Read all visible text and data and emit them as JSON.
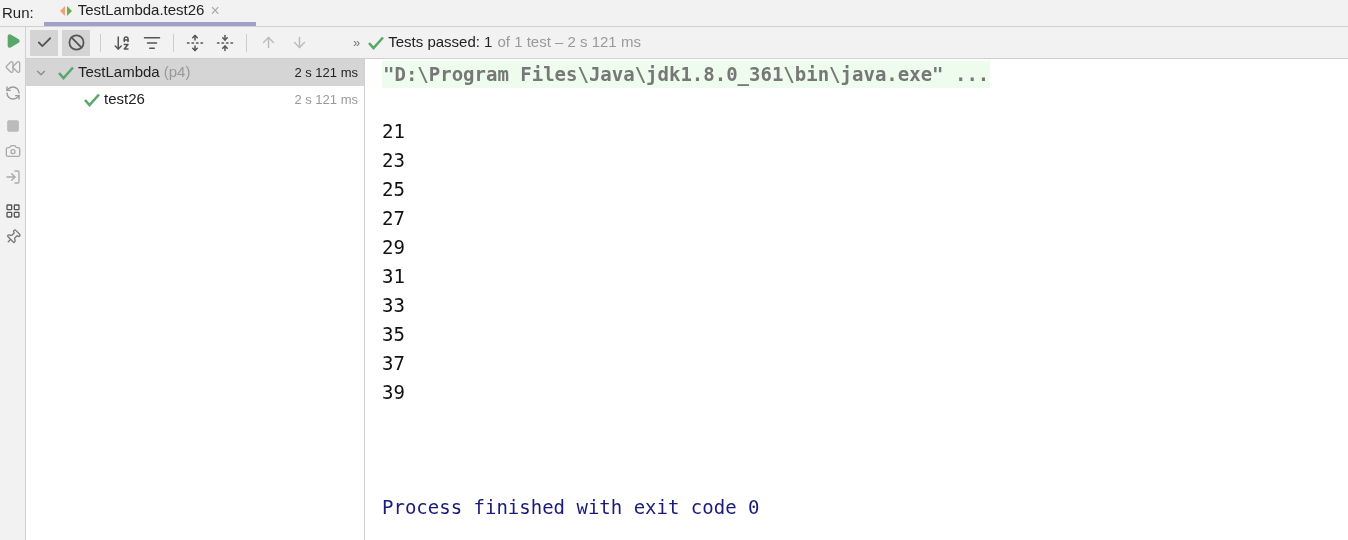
{
  "run_bar": {
    "label": "Run:",
    "tab": {
      "title": "TestLambda.test26",
      "close": "×",
      "selected": true
    }
  },
  "toolbar": {
    "toggles": [
      {
        "kind": "passed",
        "selected": true
      },
      {
        "kind": "ignored",
        "selected": true
      }
    ],
    "more": "»"
  },
  "status": {
    "strong": "Tests passed: 1",
    "rest": "of 1 test – 2 s 121 ms"
  },
  "tree": [
    {
      "name": "TestLambda",
      "detail": "(p4)",
      "time": "2 s 121 ms",
      "selected": true,
      "expanded": true,
      "children": [
        {
          "name": "test26",
          "time": "2 s 121 ms",
          "selected": false
        }
      ]
    }
  ],
  "console": {
    "command": "\"D:\\Program Files\\Java\\jdk1.8.0_361\\bin\\java.exe\" ...",
    "lines": [
      "21",
      "23",
      "25",
      "27",
      "29",
      "31",
      "33",
      "35",
      "37",
      "39"
    ],
    "footer": "Process finished with exit code 0"
  }
}
